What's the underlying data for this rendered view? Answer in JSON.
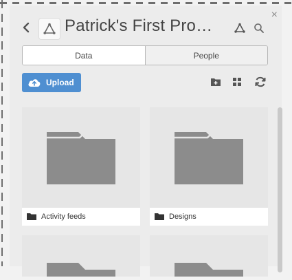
{
  "header": {
    "back_icon": "chevron-left-icon",
    "project_icon": "project-triangle-icon",
    "title": "Patrick's First Pro…",
    "share_icon": "share-network-icon",
    "search_icon": "search-icon",
    "close_icon": "close-icon"
  },
  "tabs": [
    {
      "label": "Data",
      "active": true
    },
    {
      "label": "People",
      "active": false
    }
  ],
  "toolbar": {
    "upload_label": "Upload",
    "upload_icon": "cloud-upload-icon",
    "new_folder_icon": "new-folder-icon",
    "grid_view_icon": "grid-view-icon",
    "refresh_icon": "refresh-icon"
  },
  "items": [
    {
      "name": "Activity feeds",
      "type": "folder"
    },
    {
      "name": "Designs",
      "type": "folder"
    }
  ],
  "colors": {
    "accent": "#4f8fd1",
    "folder": "#8c8c8c",
    "panel": "#ececec"
  }
}
